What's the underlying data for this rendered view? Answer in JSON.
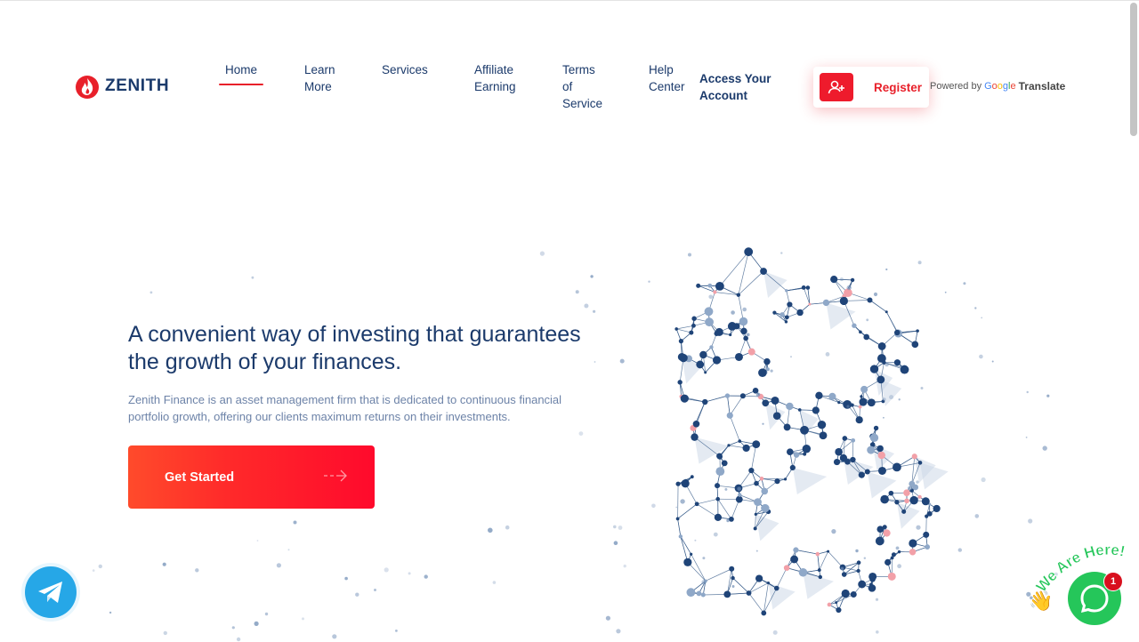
{
  "brand": {
    "name": "ZENITH",
    "flame_color": "#e8202a",
    "navy": "#1b3a6b"
  },
  "nav": {
    "home": "Home",
    "learn_more": "Learn\nMore",
    "services": "Services",
    "affiliate": "Affiliate\nEarning",
    "terms": "Terms\nof\nService",
    "help": "Help\nCenter",
    "access": "Access Your Account"
  },
  "register": {
    "label": "Register",
    "icon": "user-plus-icon"
  },
  "translate": {
    "powered_by": "Powered by",
    "google": "Google",
    "translate": "Translate"
  },
  "hero": {
    "title": "A convenient way of investing that guarantees the growth of your finances.",
    "description": "Zenith Finance is an asset management firm that is dedicated to continuous financial portfolio growth, offering our clients maximum returns on their investments.",
    "cta_label": "Get Started",
    "cta_icon": "arrow-right-icon"
  },
  "widgets": {
    "telegram_icon": "telegram-icon",
    "chat_tagline": "We Are Here!",
    "chat_badge": "1",
    "chat_icon": "whatsapp-icon"
  }
}
